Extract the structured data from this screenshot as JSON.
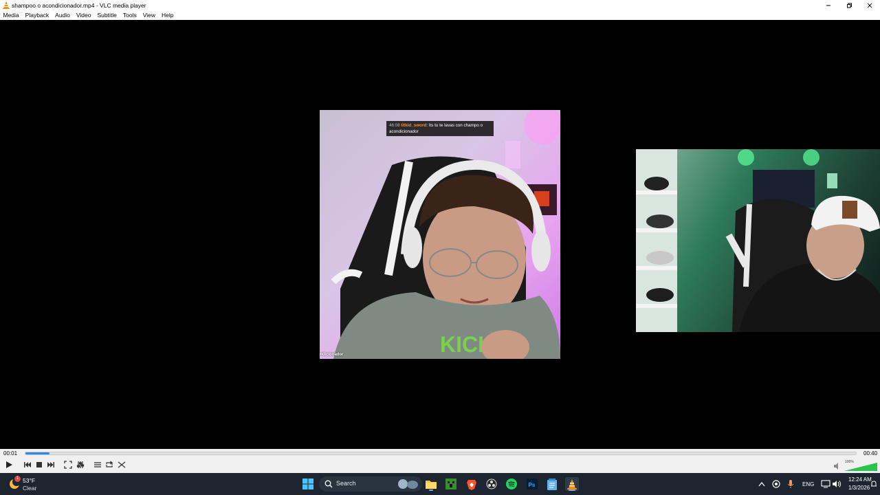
{
  "window": {
    "title": "shampoo o acondicionador.mp4 - VLC media player"
  },
  "menu": [
    "Media",
    "Playback",
    "Audio",
    "Video",
    "Subtitle",
    "Tools",
    "View",
    "Help"
  ],
  "video": {
    "chat": {
      "time": "46:08",
      "user": "litkid_sword",
      "message_line1": ": Its tu te lavas con champo o",
      "message_line2": "acondicionador"
    },
    "caption": "ndicionador",
    "logo_text": "KICK"
  },
  "player": {
    "current_time": "00:01",
    "total_time": "00:40",
    "progress_fraction": 0.029,
    "volume_label": "100%",
    "volume_fraction": 1.0,
    "accent_color": "#2a8ae6"
  },
  "taskbar": {
    "weather_temp": "53°F",
    "weather_condition": "Clear",
    "weather_badge": "1",
    "search_placeholder": "Search",
    "language": "ENG",
    "clock_time": "12:24 AM",
    "clock_date": "1/3/2026",
    "apps": [
      "start-icon",
      "search-icon",
      "widget-app-icon",
      "file-explorer-icon",
      "minecraft-icon",
      "brave-icon",
      "obs-icon",
      "spotify-icon",
      "photoshop-icon",
      "notepad-icon",
      "vlc-icon"
    ]
  }
}
